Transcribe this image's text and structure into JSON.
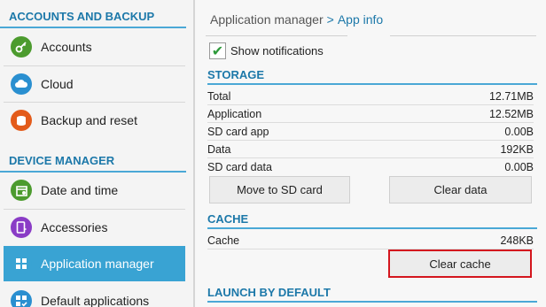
{
  "sidebar": {
    "accounts_header": "ACCOUNTS AND BACKUP",
    "device_header": "DEVICE MANAGER",
    "items": [
      {
        "label": "Accounts",
        "icon": "key-icon",
        "color": "#4c9b2e"
      },
      {
        "label": "Cloud",
        "icon": "cloud-icon",
        "color": "#2a8fd0"
      },
      {
        "label": "Backup and reset",
        "icon": "backup-icon",
        "color": "#e35b1a"
      },
      {
        "label": "Date and time",
        "icon": "calendar-icon",
        "color": "#4c9b2e"
      },
      {
        "label": "Accessories",
        "icon": "accessories-icon",
        "color": "#8a3cc6"
      },
      {
        "label": "Application manager",
        "icon": "grid-icon",
        "color": "#39a3d3"
      },
      {
        "label": "Default applications",
        "icon": "default-apps-icon",
        "color": "#2a8fd0"
      }
    ]
  },
  "breadcrumb": {
    "parent": "Application manager",
    "current": "App info"
  },
  "notifications": {
    "label": "Show notifications",
    "checked": true
  },
  "storage": {
    "header": "STORAGE",
    "rows": [
      {
        "label": "Total",
        "value": "12.71MB"
      },
      {
        "label": "Application",
        "value": "12.52MB"
      },
      {
        "label": "SD card app",
        "value": "0.00B"
      },
      {
        "label": "Data",
        "value": "192KB"
      },
      {
        "label": "SD card data",
        "value": "0.00B"
      }
    ],
    "move_button": "Move to SD card",
    "clear_data_button": "Clear data"
  },
  "cache": {
    "header": "CACHE",
    "label": "Cache",
    "value": "248KB",
    "clear_cache_button": "Clear cache"
  },
  "launch": {
    "header": "LAUNCH BY DEFAULT"
  },
  "colors": {
    "accent": "#1c78a9",
    "active_bg": "#39a3d3",
    "highlight": "#d4161e"
  }
}
